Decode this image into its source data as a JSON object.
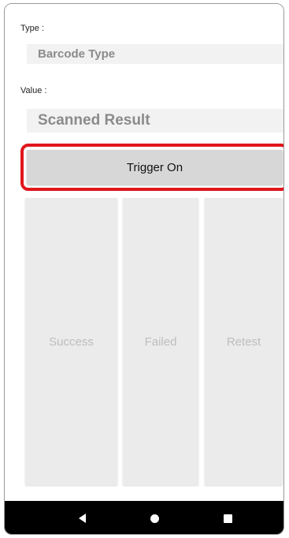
{
  "fields": {
    "type_label": "Type :",
    "type_value": "Barcode Type",
    "value_label": "Value :",
    "value_value": "Scanned Result"
  },
  "buttons": {
    "trigger": "Trigger On",
    "success": "Success",
    "failed": "Failed",
    "retest": "Retest"
  },
  "nav": {
    "back_icon": "back-triangle-icon",
    "home_icon": "home-circle-icon",
    "recents_icon": "recents-square-icon"
  },
  "colors": {
    "highlight": "#e0161c",
    "trigger_button": "#d7d7d7",
    "action_button": "#ebebeb",
    "nav_bar": "#000000"
  }
}
